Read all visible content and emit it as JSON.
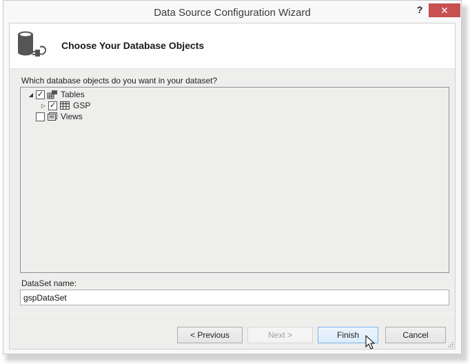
{
  "window": {
    "title": "Data Source Configuration Wizard",
    "help_label": "?",
    "close_label": "✕"
  },
  "header": {
    "icon": "database-connection-icon",
    "title": "Choose Your Database Objects"
  },
  "objects": {
    "prompt": "Which database objects do you want in your dataset?",
    "tree": [
      {
        "label": "Tables",
        "checked": true,
        "expanded": true,
        "icon": "tables-icon",
        "level": 0
      },
      {
        "label": "GSP",
        "checked": true,
        "expanded": false,
        "icon": "table-icon",
        "level": 1
      },
      {
        "label": "Views",
        "checked": false,
        "expanded": null,
        "icon": "views-icon",
        "level": 0
      }
    ]
  },
  "dataset": {
    "label": "DataSet name:",
    "value": "gspDataSet"
  },
  "buttons": {
    "previous": "< Previous",
    "next": "Next >",
    "finish": "Finish",
    "cancel": "Cancel"
  },
  "colors": {
    "close_bg": "#c75050",
    "focus_border": "#7eb4ea"
  }
}
